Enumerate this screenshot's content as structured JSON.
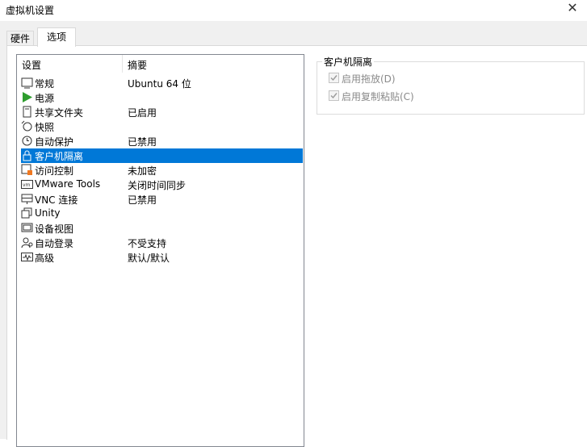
{
  "window": {
    "title": "虚拟机设置"
  },
  "tabs": [
    {
      "label": "硬件"
    },
    {
      "label": "选项"
    }
  ],
  "list": {
    "headers": {
      "settings": "设置",
      "summary": "摘要"
    },
    "items": [
      {
        "name": "常规",
        "summary": "Ubuntu 64 位",
        "icon": "general-icon"
      },
      {
        "name": "电源",
        "summary": "",
        "icon": "power-icon"
      },
      {
        "name": "共享文件夹",
        "summary": "已启用",
        "icon": "shared-folder-icon"
      },
      {
        "name": "快照",
        "summary": "",
        "icon": "snapshot-icon"
      },
      {
        "name": "自动保护",
        "summary": "已禁用",
        "icon": "autoprotect-icon"
      },
      {
        "name": "客户机隔离",
        "summary": "",
        "icon": "isolation-icon",
        "selected": true
      },
      {
        "name": "访问控制",
        "summary": "未加密",
        "icon": "access-control-icon"
      },
      {
        "name": "VMware Tools",
        "summary": "关闭时间同步",
        "icon": "vmware-tools-icon"
      },
      {
        "name": "VNC 连接",
        "summary": "已禁用",
        "icon": "vnc-icon"
      },
      {
        "name": "Unity",
        "summary": "",
        "icon": "unity-icon"
      },
      {
        "name": "设备视图",
        "summary": "",
        "icon": "device-view-icon"
      },
      {
        "name": "自动登录",
        "summary": "不受支持",
        "icon": "autologin-icon"
      },
      {
        "name": "高级",
        "summary": "默认/默认",
        "icon": "advanced-icon"
      }
    ]
  },
  "isolation": {
    "group_title": "客户机隔离",
    "drag_drop": {
      "label": "启用拖放(D)",
      "checked": true,
      "enabled": false
    },
    "copy_paste": {
      "label": "启用复制粘贴(C)",
      "checked": true,
      "enabled": false
    }
  },
  "colors": {
    "selection": "#0078d7",
    "power_green": "#2e9d2e",
    "lock_orange": "#f07820"
  }
}
